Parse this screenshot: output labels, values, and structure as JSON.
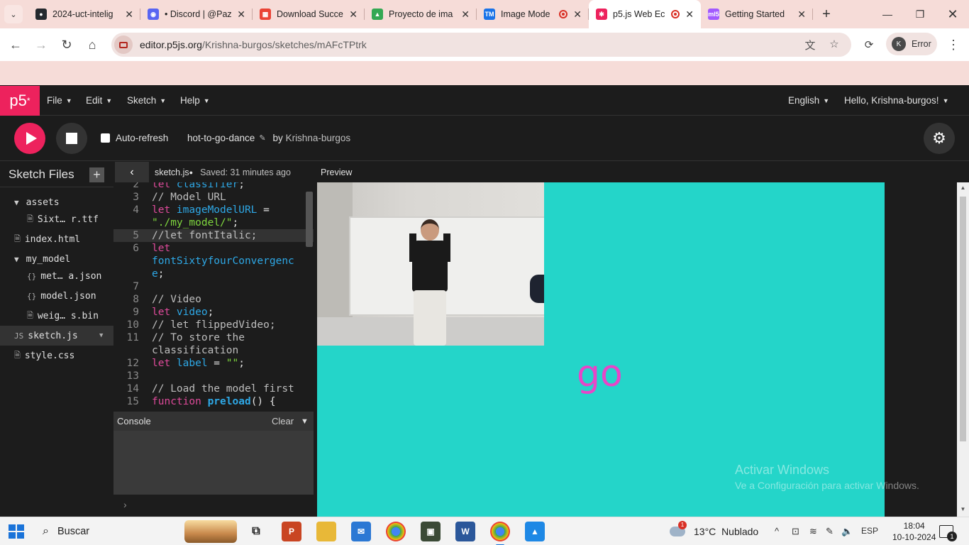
{
  "browser": {
    "tabs": [
      {
        "title": "2024-uct-intelig",
        "icon": "github-icon",
        "active": false
      },
      {
        "title": "• Discord | @Paz",
        "icon": "discord-icon",
        "active": false
      },
      {
        "title": "Download Succe",
        "icon": "download-site-icon",
        "active": false
      },
      {
        "title": "Proyecto de ima",
        "icon": "google-drive-icon",
        "active": false
      },
      {
        "title": "Image Mode",
        "icon": "teachable-machine-icon",
        "active": false,
        "recording": true
      },
      {
        "title": "p5.js Web Ec",
        "icon": "p5js-icon",
        "active": true,
        "recording": true
      },
      {
        "title": "Getting Started",
        "icon": "ml5-icon",
        "active": false
      }
    ],
    "url_host": "editor.p5js.org",
    "url_path": "/Krishna-burgos/sketches/mAFcTPtrk",
    "profile_initial": "K",
    "profile_label": "Error"
  },
  "p5": {
    "logo": "p5",
    "menus": [
      "File",
      "Edit",
      "Sketch",
      "Help"
    ],
    "language": "English",
    "greeting": "Hello, Krishna-burgos!",
    "auto_refresh_label": "Auto-refresh",
    "sketch_name": "hot-to-go-dance",
    "by_prefix": "by",
    "author": "Krishna-burgos",
    "sidebar_title": "Sketch Files",
    "files": [
      {
        "name": "assets",
        "type": "folder"
      },
      {
        "name": "Sixt… r.ttf",
        "type": "file"
      },
      {
        "name": "index.html",
        "type": "file"
      },
      {
        "name": "my_model",
        "type": "folder"
      },
      {
        "name": "met… a.json",
        "type": "json"
      },
      {
        "name": "model.json",
        "type": "json"
      },
      {
        "name": "weig… s.bin",
        "type": "file"
      },
      {
        "name": "sketch.js",
        "type": "js",
        "selected": true
      },
      {
        "name": "style.css",
        "type": "file"
      }
    ],
    "editor_file": "sketch.js",
    "saved_status": "Saved: 31 minutes ago",
    "preview_label": "Preview",
    "console_label": "Console",
    "console_clear": "Clear",
    "console_prompt": "›",
    "canvas_text": "go",
    "canvas_color": "#24d5c9",
    "text_color": "#e845c8"
  },
  "code_lines": [
    {
      "n": "2",
      "parts": [
        [
          "kw",
          "let "
        ],
        [
          "var",
          "classifier"
        ],
        [
          "pl",
          ";"
        ]
      ]
    },
    {
      "n": "3",
      "parts": [
        [
          "com",
          "// Model URL"
        ]
      ]
    },
    {
      "n": "4",
      "parts": [
        [
          "kw",
          "let "
        ],
        [
          "var",
          "imageModelURL"
        ],
        [
          "pl",
          " ="
        ]
      ]
    },
    {
      "n": "",
      "parts": [
        [
          "str",
          "\"./my_model/\""
        ],
        [
          "pl",
          ";"
        ]
      ]
    },
    {
      "n": "5",
      "parts": [
        [
          "com",
          "//let fontItalic;"
        ]
      ],
      "highlight": true
    },
    {
      "n": "6",
      "parts": [
        [
          "kw",
          "let"
        ]
      ]
    },
    {
      "n": "",
      "parts": [
        [
          "var",
          "fontSixtyfourConvergenc"
        ]
      ]
    },
    {
      "n": "",
      "parts": [
        [
          "var",
          "e"
        ],
        [
          "pl",
          ";"
        ]
      ]
    },
    {
      "n": "7",
      "parts": []
    },
    {
      "n": "8",
      "parts": [
        [
          "com",
          "// Video"
        ]
      ]
    },
    {
      "n": "9",
      "parts": [
        [
          "kw",
          "let "
        ],
        [
          "var",
          "video"
        ],
        [
          "pl",
          ";"
        ]
      ]
    },
    {
      "n": "10",
      "parts": [
        [
          "com",
          "// let flippedVideo;"
        ]
      ]
    },
    {
      "n": "11",
      "parts": [
        [
          "com",
          "// To store the"
        ]
      ]
    },
    {
      "n": "",
      "parts": [
        [
          "com",
          "classification"
        ]
      ]
    },
    {
      "n": "12",
      "parts": [
        [
          "kw",
          "let "
        ],
        [
          "var",
          "label"
        ],
        [
          "pl",
          " = "
        ],
        [
          "str",
          "\"\""
        ],
        [
          "pl",
          ";"
        ]
      ]
    },
    {
      "n": "13",
      "parts": []
    },
    {
      "n": "14",
      "parts": [
        [
          "com",
          "// Load the model first"
        ]
      ]
    },
    {
      "n": "15",
      "parts": [
        [
          "kw",
          "function "
        ],
        [
          "fn",
          "preload"
        ],
        [
          "pl",
          "() {"
        ]
      ]
    }
  ],
  "windows_watermark": {
    "line1": "Activar Windows",
    "line2": "Ve a Configuración para activar Windows."
  },
  "taskbar": {
    "search_label": "Buscar",
    "weather_badge": "1",
    "temperature": "13°C",
    "weather": "Nublado",
    "language": "ESP",
    "time": "18:04",
    "date": "10-10-2024",
    "notification_count": "1"
  }
}
